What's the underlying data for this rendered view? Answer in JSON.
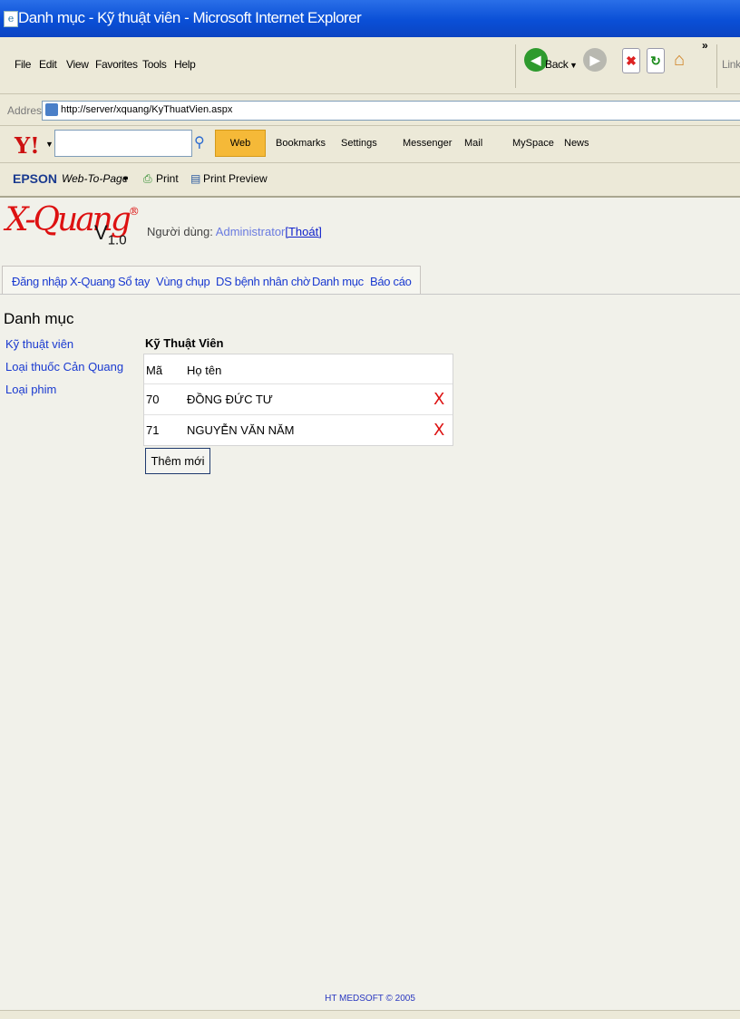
{
  "window": {
    "title": "Danh mục - Kỹ thuật viên - Microsoft Internet Explorer"
  },
  "menu": [
    "File",
    "Edit",
    "View",
    "Favorites",
    "Tools",
    "Help"
  ],
  "nav": {
    "back": "Back",
    "links": "Links"
  },
  "address": {
    "label": "Address",
    "url": "http://server/xquang/KyThuatVien.aspx"
  },
  "yahoo_toolbar": {
    "search_button": "Web Search",
    "bookmarks": "Bookmarks",
    "settings": "Settings",
    "messenger": "Messenger",
    "mail": "Mail",
    "myspace": "MySpace",
    "news": "News"
  },
  "epson_toolbar": {
    "brand": "EPSON",
    "web_to_page": "Web-To-Page",
    "print": "Print",
    "print_preview": "Print Preview"
  },
  "app": {
    "logo": "X-Quang",
    "version": "V",
    "version_num": "1.0",
    "user_label": "Người dùng:",
    "user_name": "Administrator",
    "logout": "[Thoát]"
  },
  "tabs": [
    "Đăng nhập",
    "X-Quang",
    "Sổ tay",
    "Vùng chụp",
    "DS bệnh nhân chờ",
    "Danh mục",
    "Báo cáo"
  ],
  "section_title": "Danh mục",
  "sidebar": [
    "Kỹ thuật viên",
    "Loại thuốc Cản Quang",
    "Loại phim"
  ],
  "table": {
    "title": "Kỹ Thuật Viên",
    "headers": [
      "Mã",
      "Họ tên"
    ],
    "rows": [
      {
        "code": "70",
        "name": "ĐỒNG ĐỨC TƯ",
        "delete": "X"
      },
      {
        "code": "71",
        "name": "NGUYỄN VĂN NĂM",
        "delete": "X"
      }
    ]
  },
  "add_button": "Thêm mới",
  "footer": "HT MEDSOFT © 2005"
}
